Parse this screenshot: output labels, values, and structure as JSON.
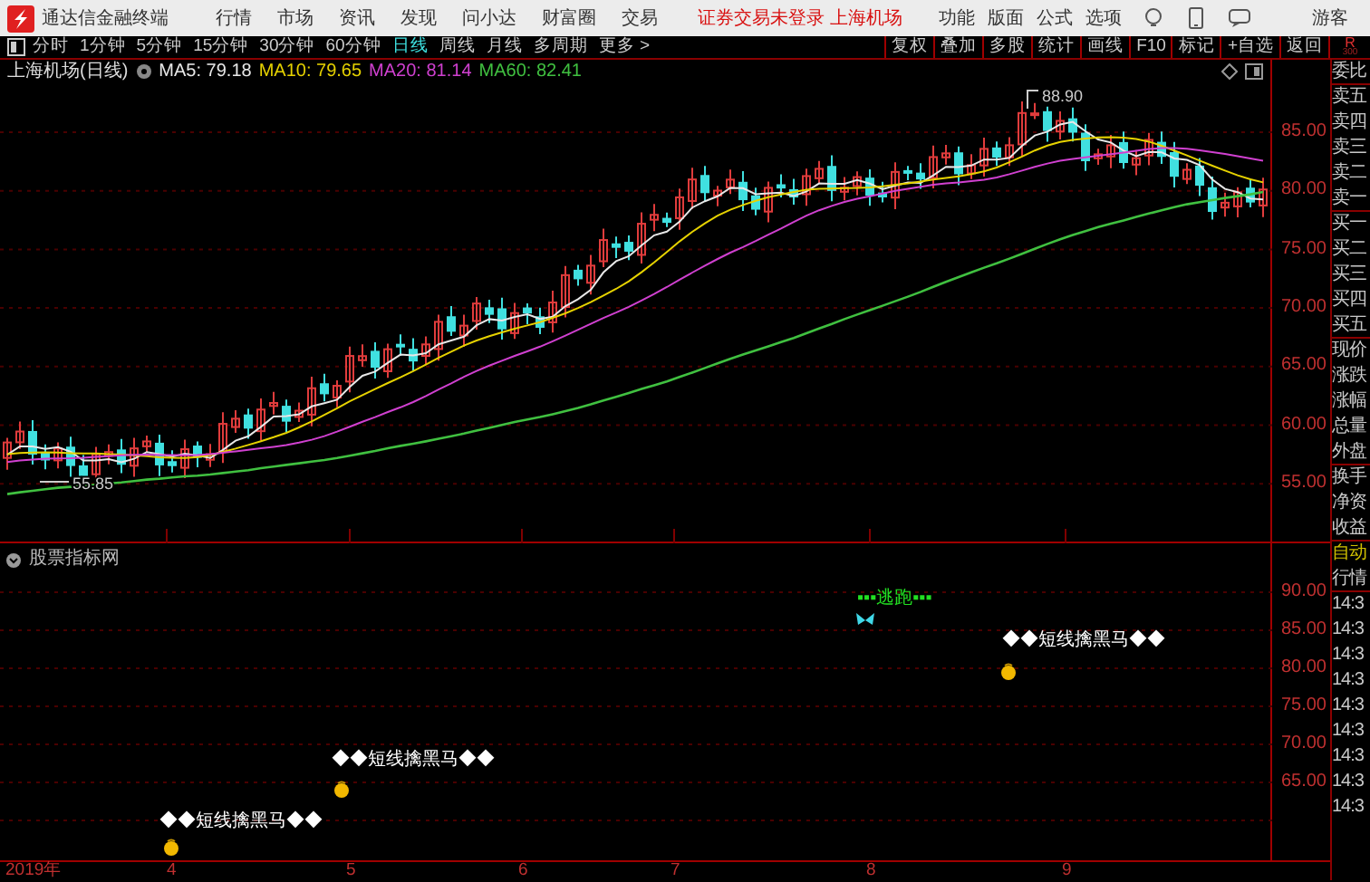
{
  "menu_bar": {
    "app_title": "通达信金融终端",
    "menus": [
      "行情",
      "市场",
      "资讯",
      "发现",
      "问小达",
      "财富圈",
      "交易"
    ],
    "notice": "证券交易未登录 上海机场",
    "right_menus": [
      "功能",
      "版面",
      "公式",
      "选项"
    ],
    "user": "游客"
  },
  "toolbar": {
    "periods": [
      {
        "label": "分时",
        "selected": false
      },
      {
        "label": "1分钟",
        "selected": false
      },
      {
        "label": "5分钟",
        "selected": false
      },
      {
        "label": "15分钟",
        "selected": false
      },
      {
        "label": "30分钟",
        "selected": false
      },
      {
        "label": "60分钟",
        "selected": false
      },
      {
        "label": "日线",
        "selected": true
      },
      {
        "label": "周线",
        "selected": false
      },
      {
        "label": "月线",
        "selected": false
      },
      {
        "label": "多周期",
        "selected": false
      }
    ],
    "more": "更多 >",
    "tools": [
      "复权",
      "叠加",
      "多股",
      "统计",
      "画线",
      "F10",
      "标记",
      "+自选",
      "返回"
    ],
    "corner": [
      "R",
      "300"
    ]
  },
  "main_chart": {
    "title": "上海机场(日线)",
    "indicators": [
      {
        "label": "MA5: 79.18",
        "color": "#e8e8e8"
      },
      {
        "label": "MA10: 79.65",
        "color": "#e6d200"
      },
      {
        "label": "MA20: 81.14",
        "color": "#d040d0"
      },
      {
        "label": "MA60: 82.41",
        "color": "#40c040"
      }
    ],
    "high_label": "88.90",
    "low_label": "55.85",
    "price_axis": [
      "85.00",
      "80.00",
      "75.00",
      "70.00",
      "65.00",
      "60.00",
      "55.00"
    ]
  },
  "indicator_panel": {
    "title": "股票指标网",
    "signals": [
      {
        "kind": "buy",
        "text": "◆◆短线擒黑马◆◆"
      },
      {
        "kind": "buy",
        "text": "◆◆短线擒黑马◆◆"
      },
      {
        "kind": "sell",
        "text": "▪▪▪逃跑▪▪▪"
      },
      {
        "kind": "buy",
        "text": "◆◆短线擒黑马◆◆"
      }
    ],
    "value_axis": [
      "90.00",
      "85.00",
      "80.00",
      "75.00",
      "70.00",
      "65.00"
    ]
  },
  "date_axis": [
    "2019年",
    "4",
    "5",
    "6",
    "7",
    "8",
    "9"
  ],
  "quote_panel": {
    "labels": [
      "委比",
      "卖五",
      "卖四",
      "卖三",
      "卖二",
      "卖一",
      "买一",
      "买二",
      "买三",
      "买四",
      "买五",
      "现价",
      "涨跌",
      "涨幅",
      "总量",
      "外盘",
      "换手",
      "净资",
      "收益"
    ],
    "mode": "自动",
    "tab": "行情",
    "times": [
      "14:3",
      "14:3",
      "14:3",
      "14:3",
      "14:3",
      "14:3",
      "14:3",
      "14:3",
      "14:3"
    ]
  }
}
